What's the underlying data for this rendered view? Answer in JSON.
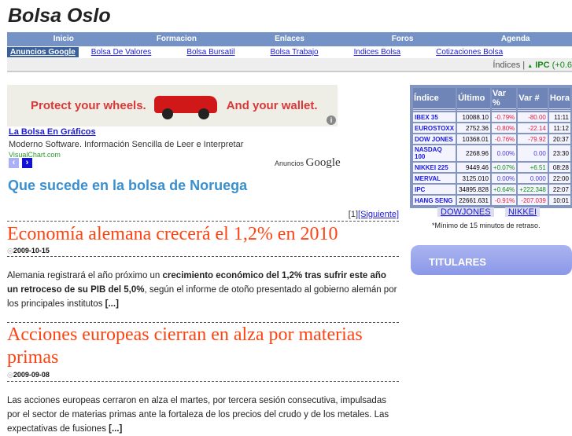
{
  "site": {
    "title": "Bolsa Oslo"
  },
  "nav": [
    "Inicio",
    "Formacion",
    "Enlaces",
    "Foros",
    "Agenda"
  ],
  "links": {
    "ads_label": "Anuncios Google",
    "items": [
      "Bolsa De Valores",
      "Bolsa Bursatil",
      "Bolsa Trabajo",
      "Indices Bolsa",
      "Cotizaciones Bolsa"
    ]
  },
  "ticker": {
    "label": "Índices |",
    "arrow": "▲",
    "name": "IPC",
    "change": "(+0.6"
  },
  "ad": {
    "left_text": "Protect your wheels.",
    "right_text": "And your wallet.",
    "info": "i",
    "link": "La Bolsa En Gráficos",
    "desc": "Moderno Software. Información Sencilla de Leer e Interpretar",
    "url": "VisualChart.com",
    "prev": "‹",
    "next": "›",
    "ads_by": "Anuncios",
    "google": "Google"
  },
  "section_title": "Que sucede en la bolsa de Noruega",
  "pager": {
    "current": "[1]",
    "next": "[Siguiente]"
  },
  "articles": [
    {
      "title": "Economía alemana crecerá el 1,2% en 2010",
      "date": "2009-10-15",
      "p1": "Alemania registrará el año próximo un ",
      "b1": "crecimiento económico del 1,2% tras sufrir este año un retroceso de su PIB del 5,0%",
      "p2": ", según el informe de otoño presentado al gobierno alemán por los principales institutos ",
      "more": "[...]"
    },
    {
      "title": "Acciones europeas cierran en alza por materias primas",
      "date": "2009-09-08",
      "p1": "Las acciones europeas cerraron en alza el martes, por tercera sesión consecutiva, impulsadas por el sector de materias primas ante la fortaleza de los precios del crudo y de los metales. Las expectativas de fusiones ",
      "more": "[...]"
    }
  ],
  "stocks": {
    "headers": [
      "Índice",
      "Último",
      "Var %",
      "Var #",
      "Hora"
    ],
    "rows": [
      [
        "IBEX 35",
        "10088.10",
        "-0.79%",
        "-80.00",
        "11:11"
      ],
      [
        "EUROSTOXX",
        "2752.36",
        "-0.80%",
        "-22.14",
        "11:12"
      ],
      [
        "DOW JONES",
        "10368.01",
        "-0.76%",
        "-79.92",
        "20:37"
      ],
      [
        "NASDAQ 100",
        "2268.96",
        "0.00%",
        "0.00",
        "23:30"
      ],
      [
        "NIKKEI 225",
        "9449.46",
        "+0.07%",
        "+6.51",
        "08:28"
      ],
      [
        "MERVAL",
        "3125.010",
        "0.00%",
        "0.000",
        "22:00"
      ],
      [
        "IPC",
        "34895.828",
        "+0.64%",
        "+222.348",
        "22:07"
      ],
      [
        "HANG SENG",
        "22661.631",
        "-0.91%",
        "-207.039",
        "10:01"
      ]
    ]
  },
  "markets": [
    "DOWJONES",
    "NIKKEI"
  ],
  "note": "*Mínimo de 15 minutos de retraso.",
  "titulares": "TITULARES"
}
